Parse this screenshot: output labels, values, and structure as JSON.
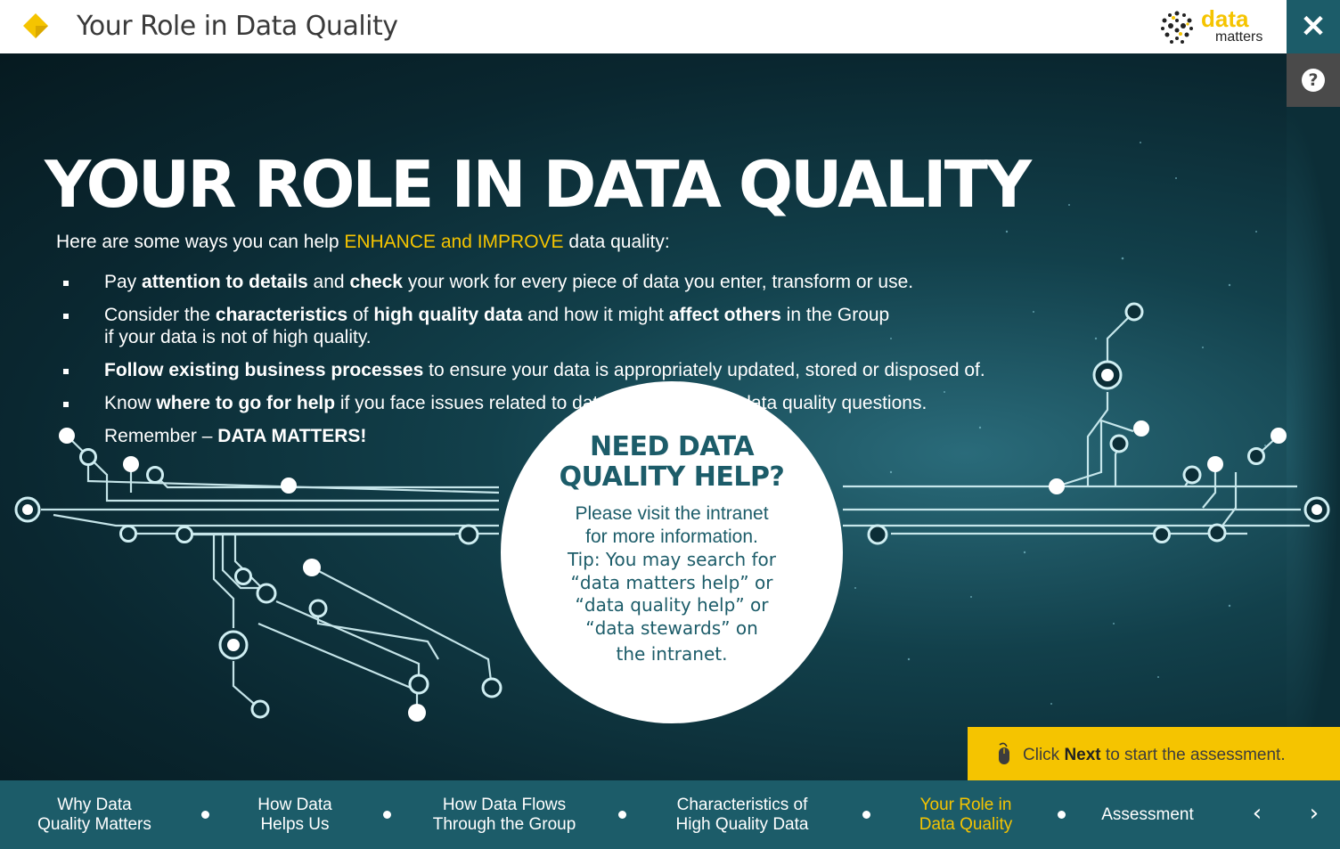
{
  "header": {
    "title": "Your Role in Data Quality",
    "brand_data": "data",
    "brand_matters": "matters",
    "close_label": "✕",
    "help_label": "?"
  },
  "main": {
    "big_title": "YOUR ROLE IN DATA QUALITY",
    "intro": {
      "before": "Here are some ways you can help ",
      "highlight": "ENHANCE and IMPROVE",
      "after": " data quality:"
    },
    "bullets": [
      [
        {
          "t": "Pay ",
          "b": false
        },
        {
          "t": "attention to details",
          "b": true
        },
        {
          "t": " and ",
          "b": false
        },
        {
          "t": "check",
          "b": true
        },
        {
          "t": " your work for every piece of data you enter, transform or use.",
          "b": false
        }
      ],
      [
        {
          "t": "Consider the ",
          "b": false
        },
        {
          "t": "characteristics",
          "b": true
        },
        {
          "t": " of ",
          "b": false
        },
        {
          "t": "high quality data",
          "b": true
        },
        {
          "t": " and how it might ",
          "b": false
        },
        {
          "t": "affect others",
          "b": true
        },
        {
          "t": " in the Group",
          "b": false
        },
        {
          "t": "\nif your data is not of high quality.",
          "b": false
        }
      ],
      [
        {
          "t": "Follow existing business processes",
          "b": true
        },
        {
          "t": " to ensure your data is appropriately updated, stored or disposed of.",
          "b": false
        }
      ],
      [
        {
          "t": "Know ",
          "b": false
        },
        {
          "t": "where to go for help",
          "b": true
        },
        {
          "t": " if you face issues related to data quality or have data quality questions.",
          "b": false
        }
      ],
      [
        {
          "t": "Remember – ",
          "b": false
        },
        {
          "t": "DATA MATTERS!",
          "b": true
        }
      ]
    ],
    "help_bubble": {
      "title_line1": "NEED DATA",
      "title_line2": "QUALITY HELP?",
      "sub_line1": "Please visit the intranet",
      "sub_line2": "for more information.",
      "tip": "Tip: You may search for “data matters help” or “data quality help” or “data stewards” on",
      "tip_end": "the intranet."
    }
  },
  "prompt": {
    "before": "Click ",
    "bold": "Next",
    "after": " to start the assessment."
  },
  "nav": {
    "items": [
      {
        "line1": "Why Data",
        "line2": "Quality Matters",
        "active": false
      },
      {
        "line1": "How Data",
        "line2": "Helps Us",
        "active": false
      },
      {
        "line1": "How Data Flows",
        "line2": "Through the Group",
        "active": false
      },
      {
        "line1": "Characteristics of",
        "line2": "High Quality Data",
        "active": false
      },
      {
        "line1": "Your Role in",
        "line2": "Data Quality",
        "active": true
      },
      {
        "line1": "Assessment",
        "line2": "",
        "active": false
      }
    ],
    "prev_label": "‹",
    "next_label": "›"
  },
  "colors": {
    "brand_yellow": "#f5c400",
    "teal_dark": "#1c5c69",
    "header_bg": "#ffffff",
    "help_bg": "#4a4a4a"
  },
  "icons": [
    "diamond-logo-icon",
    "data-matters-dots-icon",
    "close-icon",
    "help-icon",
    "mouse-icon",
    "chevron-left-icon",
    "chevron-right-icon"
  ]
}
